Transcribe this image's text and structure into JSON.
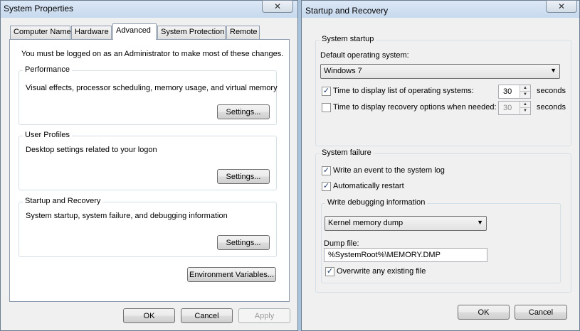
{
  "left_window": {
    "title": "System Properties",
    "close_icon": "✕",
    "tabs": [
      "Computer Name",
      "Hardware",
      "Advanced",
      "System Protection",
      "Remote"
    ],
    "active_tab": "Advanced",
    "notice": "You must be logged on as an Administrator to make most of these changes.",
    "performance": {
      "title": "Performance",
      "description": "Visual effects, processor scheduling, memory usage, and virtual memory",
      "button": "Settings..."
    },
    "user_profiles": {
      "title": "User Profiles",
      "description": "Desktop settings related to your logon",
      "button": "Settings..."
    },
    "startup_recovery": {
      "title": "Startup and Recovery",
      "description": "System startup, system failure, and debugging information",
      "button": "Settings..."
    },
    "env_button": "Environment Variables...",
    "ok": "OK",
    "cancel": "Cancel",
    "apply": "Apply"
  },
  "right_window": {
    "title": "Startup and Recovery",
    "close_icon": "✕",
    "system_startup": {
      "title": "System startup",
      "default_os_label": "Default operating system:",
      "default_os_value": "Windows 7",
      "display_list": {
        "label": "Time to display list of operating systems:",
        "checked": true,
        "value": "30",
        "unit": "seconds"
      },
      "display_recovery": {
        "label": "Time to display recovery options when needed:",
        "checked": false,
        "value": "30",
        "unit": "seconds"
      }
    },
    "system_failure": {
      "title": "System failure",
      "write_event": {
        "label": "Write an event to the system log",
        "checked": true
      },
      "auto_restart": {
        "label": "Automatically restart",
        "checked": true
      },
      "debug": {
        "title": "Write debugging information",
        "dump_type": "Kernel memory dump",
        "dump_file_label": "Dump file:",
        "dump_file_value": "%SystemRoot%\\MEMORY.DMP",
        "overwrite": {
          "label": "Overwrite any existing file",
          "checked": true
        }
      }
    },
    "ok": "OK",
    "cancel": "Cancel"
  },
  "icons": {
    "checkmark": "✓",
    "dropdown_arrow": "▼",
    "spin_up": "▲",
    "spin_down": "▼"
  },
  "colors": {
    "window_bg": "#f0f0f0",
    "title_gradient_top": "#dbe8f6",
    "desktop": "#a9c3dd"
  }
}
